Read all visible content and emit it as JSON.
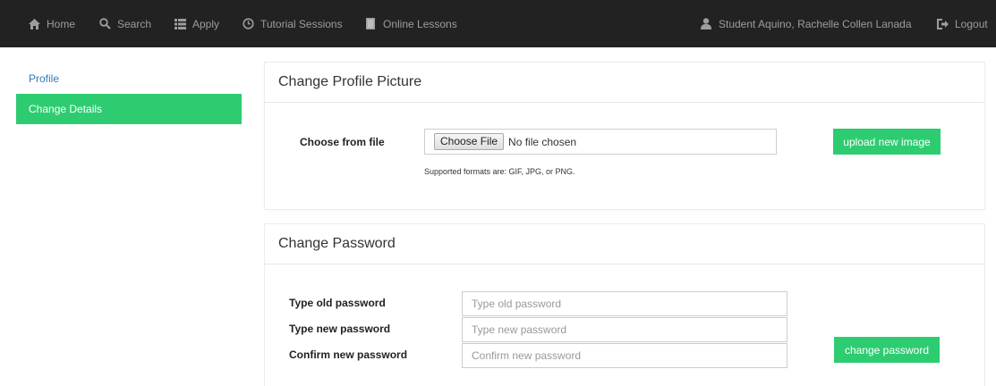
{
  "nav": {
    "home": "Home",
    "search": "Search",
    "apply": "Apply",
    "tutorial": "Tutorial Sessions",
    "lessons": "Online Lessons",
    "user": "Student Aquino, Rachelle Collen Lanada",
    "logout": "Logout"
  },
  "sidebar": {
    "items": [
      {
        "label": "Profile"
      },
      {
        "label": "Change Details"
      }
    ]
  },
  "picture": {
    "title": "Change Profile Picture",
    "file_label": "Choose from file",
    "file_button": "Choose File",
    "file_status": "No file chosen",
    "hint": "Supported formats are: GIF, JPG, or PNG.",
    "upload_button": "upload new image"
  },
  "password": {
    "title": "Change Password",
    "old_label": "Type old password",
    "old_placeholder": "Type old password",
    "new_label": "Type new password",
    "new_placeholder": "Type new password",
    "confirm_label": "Confirm new password",
    "confirm_placeholder": "Confirm new password",
    "submit_button": "change password"
  },
  "colors": {
    "navbar": "#222222",
    "nav_text": "#9d9d9d",
    "accent": "#2ecc71",
    "link": "#337ab7"
  },
  "icons": [
    "home-icon",
    "search-icon",
    "list-icon",
    "clock-icon",
    "book-icon",
    "user-icon",
    "logout-icon"
  ]
}
